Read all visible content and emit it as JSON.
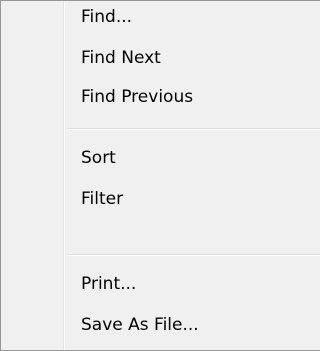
{
  "menu": {
    "groups": [
      {
        "items": [
          "Find...",
          "Find Next",
          "Find Previous"
        ]
      },
      {
        "items": [
          "Sort",
          "Filter"
        ]
      },
      {
        "items": [
          "Print...",
          "Save As File..."
        ]
      }
    ]
  },
  "colors": {
    "background": "#f0f0f0",
    "border": "#979797",
    "separator": "#e0e0e0",
    "text": "#000000"
  }
}
